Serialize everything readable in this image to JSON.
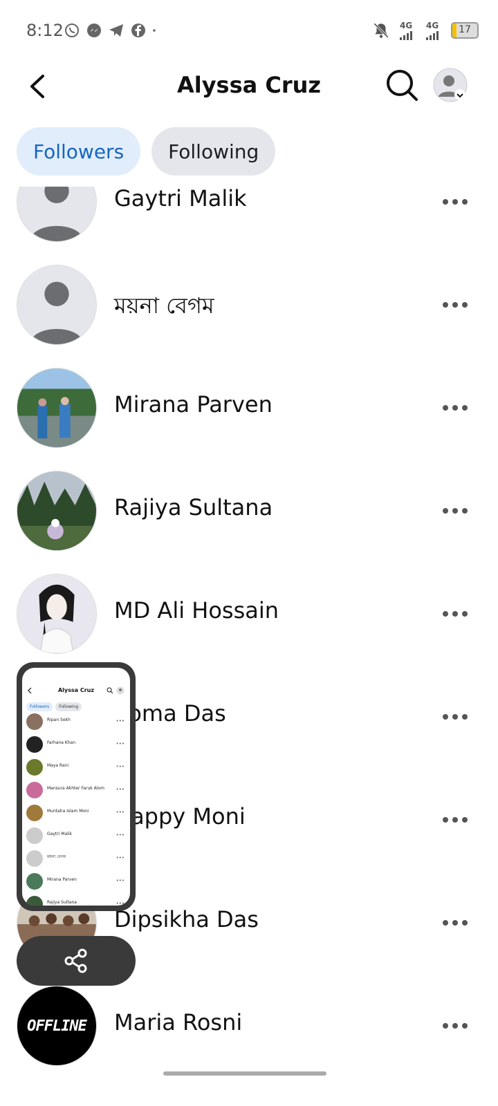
{
  "status_bar": {
    "time": "8:12",
    "left_icons": [
      "whatsapp-icon",
      "messenger-icon",
      "telegram-icon",
      "facebook-icon",
      "dot-icon"
    ],
    "network_1": "4G",
    "network_2": "4G",
    "battery_level": "17"
  },
  "header": {
    "title": "Alyssa Cruz"
  },
  "tabs": [
    {
      "label": "Followers",
      "active": true
    },
    {
      "label": "Following",
      "active": false
    }
  ],
  "followers": [
    {
      "name": "Gaytri Malik",
      "avatar": "placeholder"
    },
    {
      "name": "ময়না বেগম",
      "avatar": "placeholder"
    },
    {
      "name": "Mirana Parven",
      "avatar": "photo-park"
    },
    {
      "name": "Rajiya Sultana",
      "avatar": "photo-trees"
    },
    {
      "name": "MD Ali Hossain",
      "avatar": "illustration-girl"
    },
    {
      "name": "Soma Das",
      "avatar": "photo"
    },
    {
      "name": "Happy Moni",
      "avatar": "photo"
    },
    {
      "name": "Dipsikha Das",
      "avatar": "photo-group"
    },
    {
      "name": "Maria Rosni",
      "avatar": "offline-logo",
      "avatar_text": "OFFLINE"
    }
  ],
  "mini_preview": {
    "title": "Alyssa Cruz",
    "tabs": [
      "Followers",
      "Following"
    ],
    "rows": [
      "Ripan Sekh",
      "Farhana Khan",
      "Maya Rani",
      "Mansura Akhter Faruk Alom",
      "Muntaha Islam Moni",
      "Gaytri Malik",
      "ময়না বেগম",
      "Mirana Parven",
      "Rajiya Sultana"
    ]
  },
  "colors": {
    "accent": "#1565c0",
    "active_tab_bg": "#e1edfb",
    "inactive_tab_bg": "#e4e6eb",
    "floating_bg": "#3a3a3a"
  }
}
